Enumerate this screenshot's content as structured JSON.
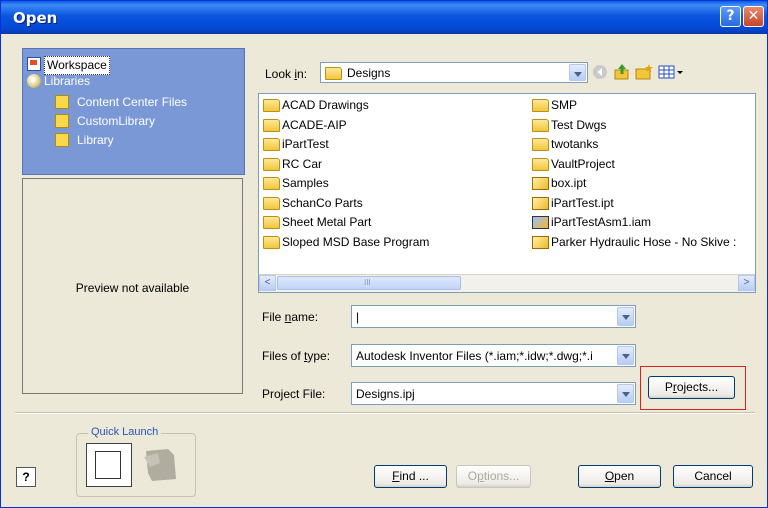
{
  "window": {
    "title": "Open",
    "help_glyph": "?",
    "close_glyph": "✕"
  },
  "left_pane": {
    "items": [
      {
        "label": "Workspace",
        "icon": "workspace-icon"
      },
      {
        "label": "Libraries",
        "icon": "libraries-icon"
      },
      {
        "label": "Content Center Files",
        "icon": "folder-icon"
      },
      {
        "label": "CustomLibrary",
        "icon": "folder-icon"
      },
      {
        "label": "Library",
        "icon": "folder-icon"
      }
    ]
  },
  "preview": {
    "text": "Preview not available"
  },
  "look_in": {
    "label_pre": "Look ",
    "label_key": "i",
    "label_post": "n:",
    "value": "Designs"
  },
  "toolbar": {
    "icons": [
      "back-icon",
      "up-folder-icon",
      "new-folder-icon",
      "view-menu-icon"
    ]
  },
  "file_list": {
    "col1": [
      {
        "name": "ACAD Drawings",
        "type": "folder"
      },
      {
        "name": "ACADE-AIP",
        "type": "folder"
      },
      {
        "name": "iPartTest",
        "type": "folder"
      },
      {
        "name": "RC Car",
        "type": "folder"
      },
      {
        "name": "Samples",
        "type": "folder"
      },
      {
        "name": "SchanCo Parts",
        "type": "folder"
      },
      {
        "name": "Sheet Metal Part",
        "type": "folder"
      },
      {
        "name": "Sloped MSD Base Program",
        "type": "folder"
      }
    ],
    "col2": [
      {
        "name": "SMP",
        "type": "folder"
      },
      {
        "name": "Test Dwgs",
        "type": "folder"
      },
      {
        "name": "twotanks",
        "type": "folder"
      },
      {
        "name": "VaultProject",
        "type": "folder"
      },
      {
        "name": "box.ipt",
        "type": "part"
      },
      {
        "name": "iPartTest.ipt",
        "type": "part"
      },
      {
        "name": "iPartTestAsm1.iam",
        "type": "assembly"
      },
      {
        "name": "Parker Hydraulic Hose - No Skive :",
        "type": "part"
      }
    ]
  },
  "scrollbar": {
    "left_arrow": "<",
    "right_arrow": ">",
    "thumb_grip": "III"
  },
  "file_name": {
    "label_pre": "File ",
    "label_key": "n",
    "label_post": "ame:",
    "value": "|"
  },
  "file_type": {
    "label_pre": "Files of ",
    "label_key": "t",
    "label_post": "ype:",
    "value": "Autodesk Inventor Files (*.iam;*.idw;*.dwg;*.i"
  },
  "project_file": {
    "label": "Project File:",
    "value": "Designs.ipj"
  },
  "buttons": {
    "projects": {
      "pre": "P",
      "key": "r",
      "post": "ojects..."
    },
    "find": {
      "pre": "",
      "key": "F",
      "post": "ind ..."
    },
    "options": {
      "pre": "O",
      "key": "p",
      "post": "tions..."
    },
    "open": {
      "pre": "",
      "key": "O",
      "post": "pen"
    },
    "cancel": {
      "label": "Cancel"
    }
  },
  "quick_launch": {
    "label": "Quick Launch"
  },
  "help_button": {
    "glyph": "?"
  }
}
